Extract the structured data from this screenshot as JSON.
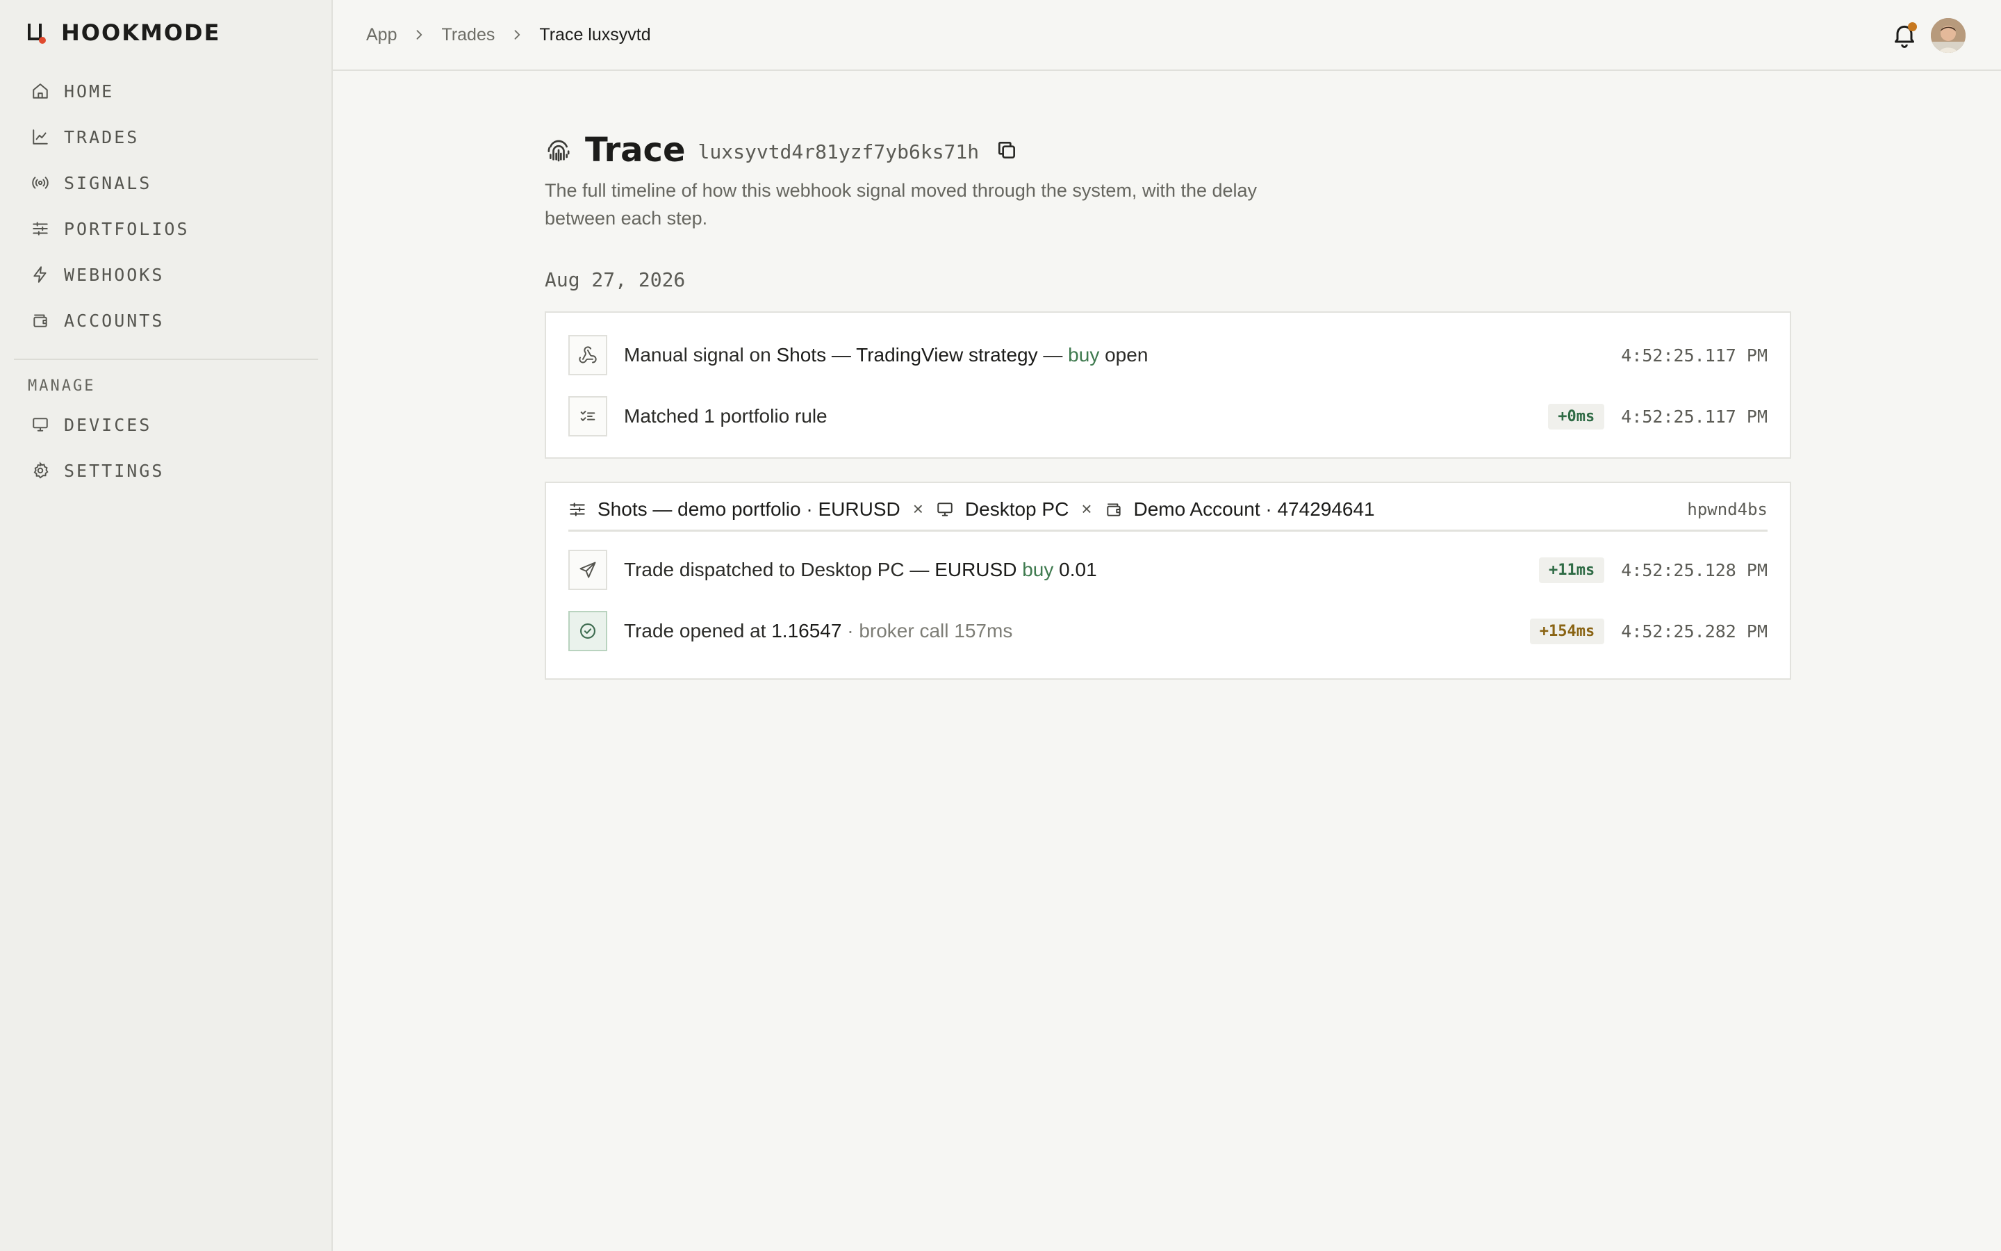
{
  "brand": {
    "name": "HOOKMODE"
  },
  "sidebar": {
    "items": [
      {
        "label": "HOME"
      },
      {
        "label": "TRADES"
      },
      {
        "label": "SIGNALS"
      },
      {
        "label": "PORTFOLIOS"
      },
      {
        "label": "WEBHOOKS"
      },
      {
        "label": "ACCOUNTS"
      }
    ],
    "section_label": "MANAGE",
    "manage_items": [
      {
        "label": "DEVICES"
      },
      {
        "label": "SETTINGS"
      }
    ]
  },
  "header": {
    "breadcrumbs": [
      "App",
      "Trades",
      "Trace luxsyvtd"
    ]
  },
  "page": {
    "title": "Trace",
    "trace_id": "luxsyvtd4r81yzf7yb6ks71h",
    "description": "The full timeline of how this webhook signal moved through the system, with the delay between each step.",
    "date": "Aug 27, 2026"
  },
  "signal_card": {
    "row1": {
      "prefix": "Manual signal on ",
      "strategy": "Shots — TradingView strategy",
      "sep": " — ",
      "side": "buy",
      "action": " open",
      "time": "4:52:25.117 PM"
    },
    "row2": {
      "prefix": "Matched ",
      "count": "1",
      "suffix": " portfolio rule",
      "delta": "+0ms",
      "time": "4:52:25.117 PM"
    }
  },
  "execution_card": {
    "portfolio": "Shots — demo portfolio · EURUSD",
    "device": "Desktop PC",
    "account": "Demo Account · 474294641",
    "separator": "×",
    "exec_id": "hpwnd4bs",
    "row1": {
      "prefix": "Trade dispatched to Desktop PC — ",
      "symbol": "EURUSD",
      "side": "buy",
      "qty": "0.01",
      "delta": "+11ms",
      "time": "4:52:25.128 PM"
    },
    "row2": {
      "prefix": "Trade opened at ",
      "price": "1.16547",
      "suffix": " · broker call 157ms",
      "delta": "+154ms",
      "time": "4:52:25.282 PM"
    }
  },
  "colors": {
    "accent_buy": "#3f7a4f",
    "brand_dot": "#e04a2e",
    "notification_dot": "#c7781e",
    "delta_slow": "#8a6414"
  }
}
